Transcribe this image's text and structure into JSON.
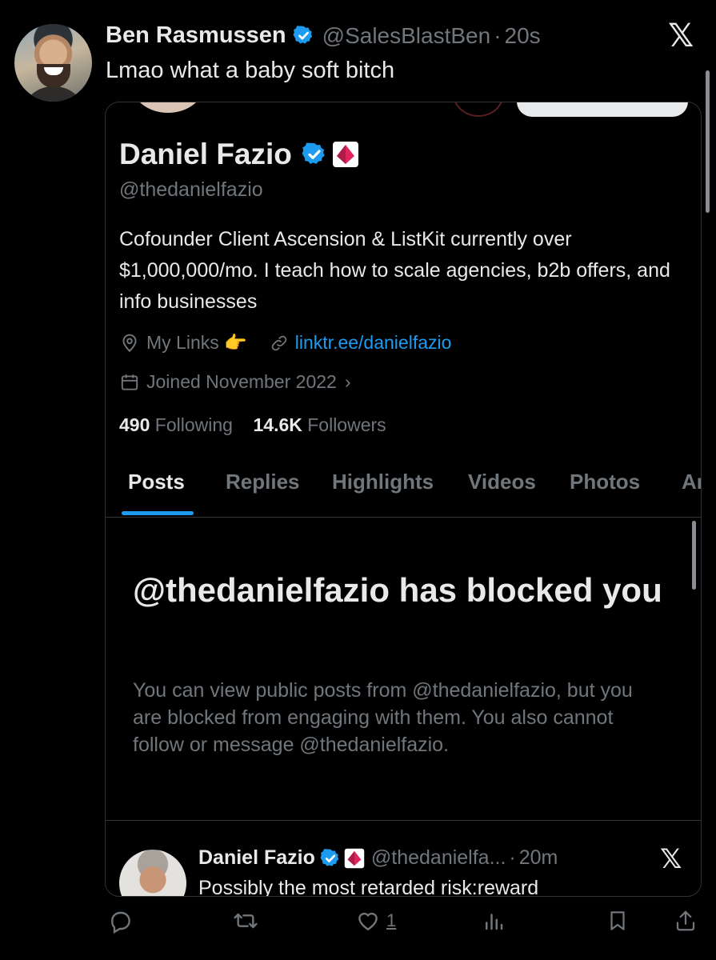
{
  "tweet": {
    "author_name": "Ben Rasmussen",
    "handle": "@SalesBlastBen",
    "separator": "·",
    "time": "20s",
    "text": "Lmao what a baby soft bitch"
  },
  "embedded": {
    "profile": {
      "name": "Daniel Fazio",
      "handle": "@thedanielfazio",
      "bio": "Cofounder Client Ascension & ListKit currently over $1,000,000/mo. I teach how to scale agencies, b2b offers, and info businesses",
      "links_label": "My Links 👉",
      "link_url": "linktr.ee/danielfazio",
      "joined": "Joined November 2022",
      "following_count": "490",
      "following_label": "Following",
      "followers_count": "14.6K",
      "followers_label": "Followers"
    },
    "tabs": [
      "Posts",
      "Replies",
      "Highlights",
      "Videos",
      "Photos",
      "Ar"
    ],
    "active_tab": "Posts",
    "blocked": {
      "title": "@thedanielfazio has blocked you",
      "body": "You can view public posts from @thedanielfazio, but you are blocked from engaging with them. You also cannot follow or message @thedanielfazio."
    },
    "inner_post": {
      "name": "Daniel Fazio",
      "handle": "@thedanielfa...",
      "separator": "·",
      "time": "20m",
      "text": "Possibly the most retarded risk:reward"
    }
  },
  "actions": {
    "like_count": "1"
  },
  "icons": {
    "brand_logo": "x-logo-icon",
    "verified": "verified-badge-icon",
    "affiliate": "affiliate-badge-icon",
    "location": "location-icon",
    "link": "link-icon",
    "calendar": "calendar-icon",
    "reply": "reply-icon",
    "repost": "repost-icon",
    "like": "heart-icon",
    "views": "views-icon",
    "bookmark": "bookmark-icon",
    "share": "share-icon"
  },
  "colors": {
    "background": "#000000",
    "text_primary": "#e7e9ea",
    "text_secondary": "#71767b",
    "accent": "#1d9bf0",
    "border": "#2f3336",
    "affiliate_red": "#e0245e"
  }
}
